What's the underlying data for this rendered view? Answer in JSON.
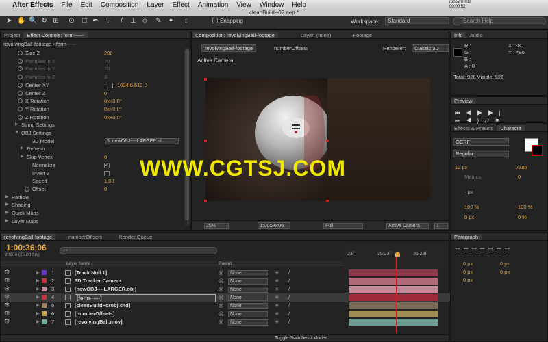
{
  "menubar": {
    "apple": "",
    "app": "After Effects",
    "items": [
      "File",
      "Edit",
      "Composition",
      "Layer",
      "Effect",
      "Animation",
      "View",
      "Window",
      "Help"
    ],
    "right": "iShowU HD\n00:00:52"
  },
  "window_title": "cleanBuild--02.aep *",
  "toolbar": {
    "snapping": "Snapping",
    "workspace_label": "Workspace:",
    "workspace_value": "Standard",
    "search_placeholder": "Search Help"
  },
  "project_tab": "Project",
  "effect_controls": {
    "tab": "Effect Controls: form------",
    "breadcrumb": "revolvingBall-footage • form------",
    "rows": [
      {
        "label": "Size Z",
        "value": "200",
        "stopwatch": true,
        "state": "active"
      },
      {
        "label": "Particles in X",
        "value": "70",
        "stopwatch": true,
        "state": "dim"
      },
      {
        "label": "Particles in Y",
        "value": "70",
        "stopwatch": true,
        "state": "dim"
      },
      {
        "label": "Particles in Z",
        "value": "3",
        "stopwatch": true,
        "state": "dim"
      },
      {
        "label": "Center XY",
        "value": "1024.0,512.0",
        "stopwatch": true,
        "state": "active"
      },
      {
        "label": "Center Z",
        "value": "0",
        "stopwatch": true,
        "state": "active"
      },
      {
        "label": "X Rotation",
        "value": "0x+0.0°",
        "stopwatch": true,
        "state": "active"
      },
      {
        "label": "Y Rotation",
        "value": "0x+0.0°",
        "stopwatch": true,
        "state": "active"
      },
      {
        "label": "Z Rotation",
        "value": "0x+0.0°",
        "stopwatch": true,
        "state": "active"
      },
      {
        "label": "String Settings",
        "value": "",
        "stopwatch": false,
        "state": "group"
      },
      {
        "label": "OBJ Settings",
        "value": "",
        "stopwatch": false,
        "state": "group-open"
      },
      {
        "label": "3D Model",
        "value": "3. newOBJ----LARGER.ol",
        "stopwatch": false,
        "state": "dropdown"
      },
      {
        "label": "Refresh",
        "value": "",
        "stopwatch": false,
        "state": "group"
      },
      {
        "label": "Skip Vertex",
        "value": "0",
        "stopwatch": false,
        "state": "group"
      },
      {
        "label": "Normalize",
        "value": "✓",
        "stopwatch": false,
        "state": "check"
      },
      {
        "label": "Invert Z",
        "value": "",
        "stopwatch": false,
        "state": "check"
      },
      {
        "label": "Speed",
        "value": "1.00",
        "stopwatch": false,
        "state": "active"
      },
      {
        "label": "Offset",
        "value": "0",
        "stopwatch": true,
        "state": "active"
      },
      {
        "label": "Particle",
        "value": "",
        "stopwatch": false,
        "state": "top"
      },
      {
        "label": "Shading",
        "value": "",
        "stopwatch": false,
        "state": "top"
      },
      {
        "label": "Quick Maps",
        "value": "",
        "stopwatch": false,
        "state": "top"
      },
      {
        "label": "Layer Maps",
        "value": "",
        "stopwatch": false,
        "state": "top"
      }
    ]
  },
  "composition": {
    "tab": "Composition: revolvingBall-footage",
    "layer_tab": "Layer: (none)",
    "footage_tab": "Footage",
    "crumb1": "revolvingBall-footage",
    "crumb2": "numberOffsets",
    "renderer_label": "Renderer:",
    "renderer": "Classic 3D",
    "camera_label": "Active Camera",
    "watermark": "WWW.CGTSJ.COM",
    "footer": {
      "zoom": "25%",
      "timecode": "1:00:36:06",
      "quality": "Full",
      "view": "Active Camera",
      "views": "1"
    }
  },
  "info": {
    "tab": "Info",
    "audio_tab": "Audio",
    "r": "R :",
    "g": "G :",
    "b": "B :",
    "a": "A : 0",
    "x": "X : -80",
    "y": "Y : 480",
    "total": "Total: 926  Visible: 926"
  },
  "preview": {
    "tab": "Preview"
  },
  "effects_tab": "Effects & Presets",
  "character_tab": "Characte",
  "character": {
    "font": "OCRF",
    "style": "Regular",
    "size": "12 px",
    "leading": "Auto",
    "tracking_label": "Metrics",
    "tracking": "0",
    "stroke": "- px",
    "vscale": "100 %",
    "hscale": "100 %",
    "baseline": "0 px",
    "tsume": "0 %"
  },
  "paragraph": {
    "tab": "Paragraph",
    "values": [
      "0 px",
      "0 px",
      "0 px",
      "0 px",
      "0 px"
    ]
  },
  "timeline": {
    "tabs": [
      "revolvingBall-footage",
      "numberOffsets",
      "Render Queue"
    ],
    "timecode": "1:00:36:06",
    "frames": "90906 (25.00 fps)",
    "search_placeholder": "⌕▾",
    "col_layer": "Layer Name",
    "col_parent": "Parent",
    "ruler": [
      "23f",
      "35:23f",
      "36:23f"
    ],
    "footer": "Toggle Switches / Modes",
    "layers": [
      {
        "num": "1",
        "name": "[Track Null 1]",
        "color": "#6a2fd6",
        "parent": "None",
        "bar": "#8a3a4a"
      },
      {
        "num": "2",
        "name": "3D Tracker Camera",
        "color": "#c9323e",
        "parent": "None",
        "bar": "#b06a7a"
      },
      {
        "num": "3",
        "name": "[newOBJ----LARGER.obj]",
        "color": "#c9889a",
        "parent": "None",
        "bar": "#c08a98"
      },
      {
        "num": "4",
        "name": "[form------]",
        "color": "#c9323e",
        "parent": "None",
        "bar": "#a02a3a"
      },
      {
        "num": "5",
        "name": "[cleanBuildForobj.c4d]",
        "color": "#a08060",
        "parent": "None",
        "bar": "#7a6a58"
      },
      {
        "num": "6",
        "name": "[numberOffsets]",
        "color": "#c9a040",
        "parent": "None",
        "bar": "#a08a55"
      },
      {
        "num": "7",
        "name": "[revolvingBall.mov]",
        "color": "#6ab0a0",
        "parent": "None",
        "bar": "#6a9a90"
      }
    ]
  }
}
